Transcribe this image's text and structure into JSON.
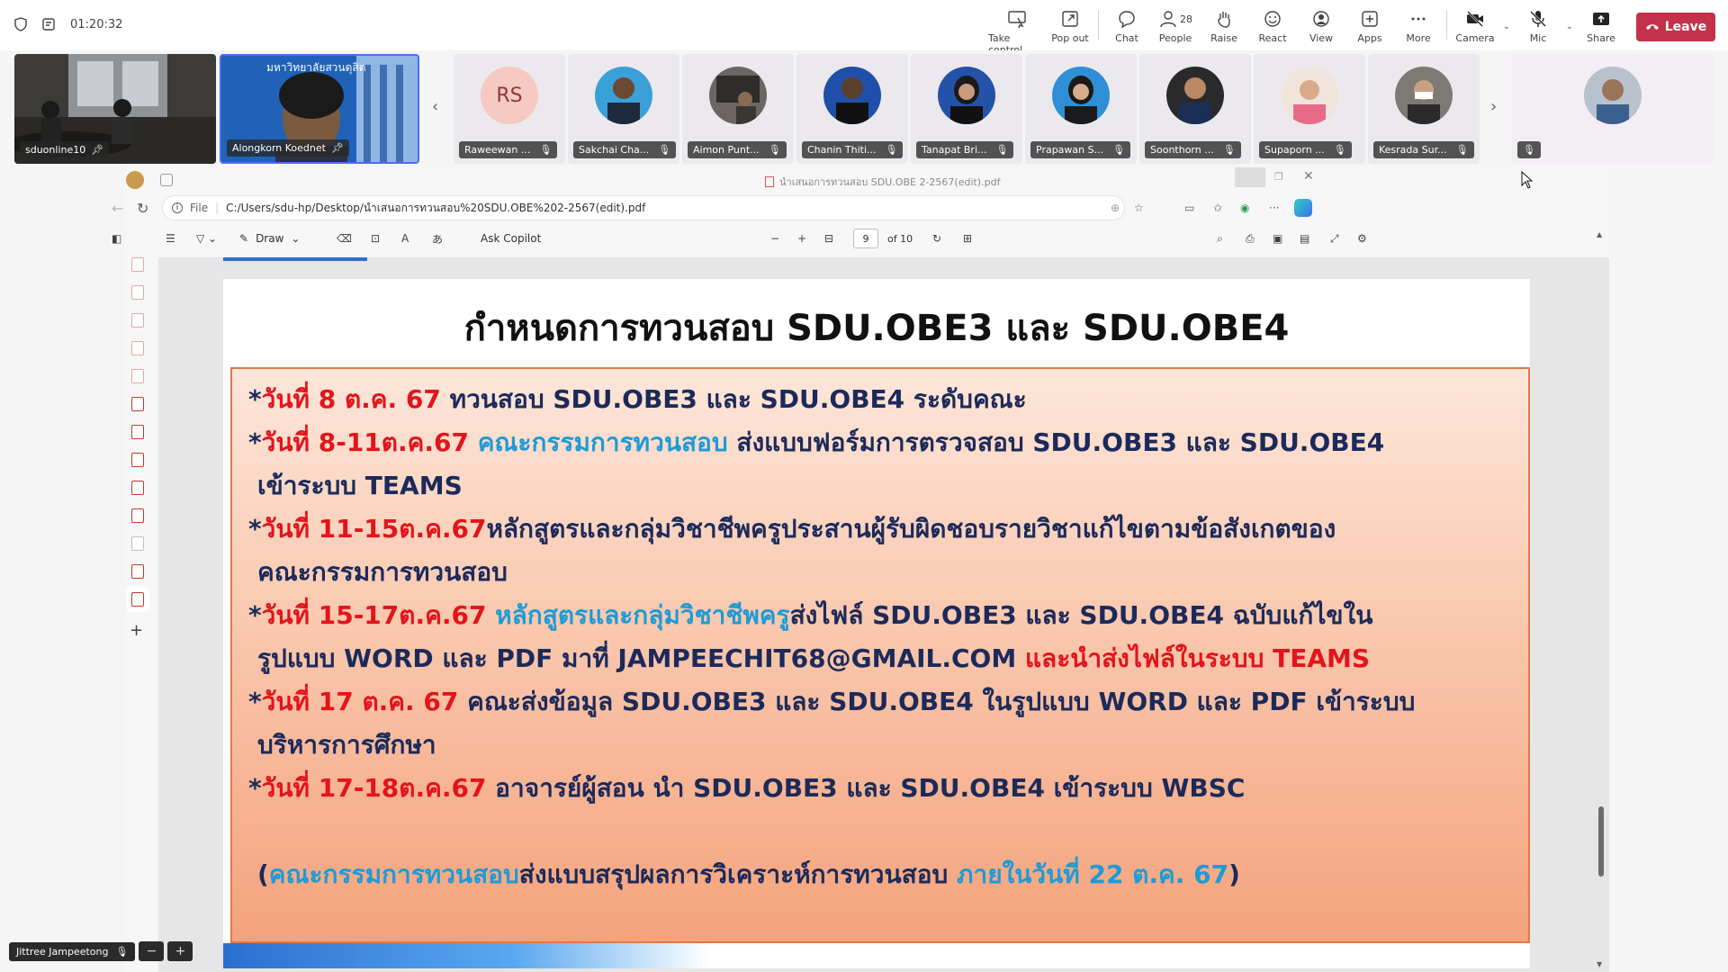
{
  "meeting": {
    "timer": "01:20:32",
    "controls": [
      {
        "label": "Take control",
        "icon": "take-control-icon"
      },
      {
        "label": "Pop out",
        "icon": "pop-out-icon"
      },
      {
        "label": "Chat",
        "icon": "chat-icon"
      },
      {
        "label": "People",
        "icon": "people-icon",
        "count": "28"
      },
      {
        "label": "Raise",
        "icon": "raise-hand-icon"
      },
      {
        "label": "React",
        "icon": "react-icon"
      },
      {
        "label": "View",
        "icon": "view-icon"
      },
      {
        "label": "Apps",
        "icon": "apps-icon"
      },
      {
        "label": "More",
        "icon": "more-icon"
      },
      {
        "label": "Camera",
        "icon": "camera-off-icon"
      },
      {
        "label": "Mic",
        "icon": "mic-off-icon"
      },
      {
        "label": "Share",
        "icon": "share-icon"
      }
    ],
    "leave_label": "Leave",
    "self_name": "Jittree Jampeetong"
  },
  "gallery": {
    "video_tiles": [
      {
        "name": "sduonline10"
      },
      {
        "name": "Alongkorn Koednet",
        "banner": "มหาวิทยาลัยสวนดุสิต"
      }
    ],
    "participants": [
      {
        "name": "Raweewan ...",
        "initials": "RS"
      },
      {
        "name": "Sakchai Cha..."
      },
      {
        "name": "Aimon Punt..."
      },
      {
        "name": "Chanin Thiti..."
      },
      {
        "name": "Tanapat Bri..."
      },
      {
        "name": "Prapawan S..."
      },
      {
        "name": "Soonthorn ..."
      },
      {
        "name": "Supaporn ..."
      },
      {
        "name": "Kesrada Sur..."
      }
    ]
  },
  "viewer": {
    "window_title": "นำเสนอการทวนสอบ SDU.OBE 2-2567(edit).pdf",
    "file_label": "File",
    "path": "C:/Users/sdu-hp/Desktop/นำเสนอการทวนสอบ%20SDU.OBE%202-2567(edit).pdf",
    "draw_label": "Draw",
    "ask_copilot": "Ask Copilot",
    "page_current": "9",
    "page_total": "of 10"
  },
  "slide": {
    "title": "กำหนดการทวนสอบ SDU.OBE3 และ SDU.OBE4",
    "lines": [
      {
        "red": "วันที่ 8 ต.ค. 67",
        "rest": " ทวนสอบ SDU.OBE3 และ SDU.OBE4 ระดับคณะ"
      },
      {
        "red": "วันที่ 8-11ต.ค.67",
        "blue": " คณะกรรมการทวนสอบ",
        "rest": " ส่งแบบฟอร์มการตรวจสอบ SDU.OBE3 และ SDU.OBE4"
      },
      {
        "rest": "เข้าระบบ TEAMS"
      },
      {
        "red": "วันที่ 11-15ต.ค.67",
        "rest": "หลักสูตรและกลุ่มวิชาชีพครูประสานผู้รับผิดชอบรายวิชาแก้ไขตามข้อสังเกตของ"
      },
      {
        "rest": "คณะกรรมการทวนสอบ"
      },
      {
        "red": "วันที่ 15-17ต.ค.67",
        "blue": " หลักสูตรและกลุ่มวิชาชีพครู",
        "rest": "ส่งไฟล์ SDU.OBE3 และ SDU.OBE4 ฉบับแก้ไขใน"
      },
      {
        "rest": "รูปแบบ WORD และ PDF มาที่ JAMPEECHIT68@GMAIL.COM",
        "red_tail": " และนำส่งไฟล์ในระบบ TEAMS"
      },
      {
        "red": "วันที่ 17 ต.ค. 67",
        "rest": " คณะส่งข้อมูล SDU.OBE3 และ SDU.OBE4 ในรูปแบบ WORD และ PDF เข้าระบบ"
      },
      {
        "rest": "บริหารการศึกษา"
      },
      {
        "red": "วันที่ 17-18ต.ค.67",
        "rest": " อาจารย์ผู้สอน นำ SDU.OBE3 และ SDU.OBE4 เข้าระบบ WBSC"
      }
    ],
    "footer": {
      "open": "(",
      "blue1": "คณะกรรมการทวนสอบ",
      "rest": "ส่งแบบสรุปผลการวิเคราะห์การทวนสอบ ",
      "blue2": "ภายในวันที่ 22 ต.ค. 67",
      "close": ")"
    }
  },
  "colors": {
    "leave": "#c4314b",
    "slide_red": "#e3141b",
    "slide_blue": "#1e9bd6",
    "slide_text": "#1c2a5a"
  }
}
